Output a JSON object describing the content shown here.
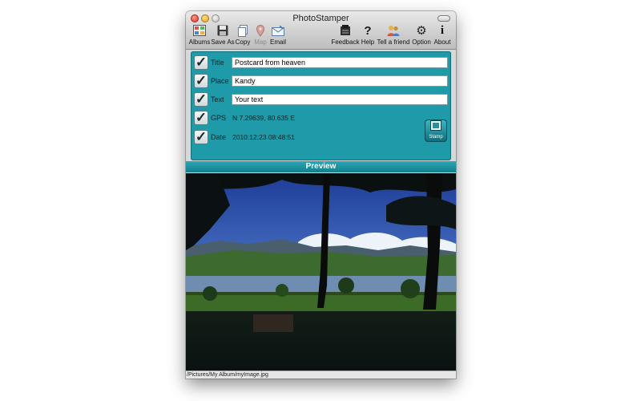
{
  "window": {
    "title": "PhotoStamper"
  },
  "toolbar": {
    "albums": "Albums",
    "save_as": "Save As",
    "copy": "Copy",
    "map": "Map",
    "email": "Email",
    "feedback": "Feedback",
    "help": "Help",
    "tell_a_friend": "Tell a friend",
    "option": "Option",
    "about": "About"
  },
  "form": {
    "title": {
      "label": "Title",
      "value": "Postcard from heaven",
      "checked": true
    },
    "place": {
      "label": "Place",
      "value": "Kandy",
      "checked": true
    },
    "text": {
      "label": "Text",
      "value": "Your text",
      "checked": true
    },
    "gps": {
      "label": "GPS",
      "value": "N 7.29639,  80.635 E",
      "checked": true
    },
    "date": {
      "label": "Date",
      "value": "2010:12:23 08:48:51",
      "checked": true
    },
    "stamp_label": "Stamp"
  },
  "preview": {
    "label": "Preview"
  },
  "status": {
    "path": "/Pictures/My Album/myImage.jpg"
  },
  "colors": {
    "panel": "#1f9aa8",
    "preview_bar": "#13808c"
  }
}
